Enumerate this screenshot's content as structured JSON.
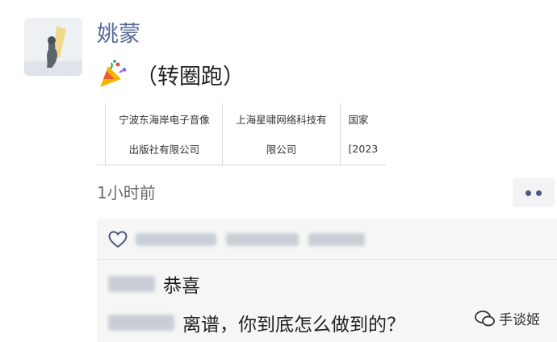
{
  "post": {
    "author": "姚蒙",
    "text": "（转圈跑）",
    "emoji": "party-popper",
    "media_table": {
      "row1": [
        "宁波东海岸电子音像",
        "上海星啸网络科技有",
        "国家"
      ],
      "row2": [
        "出版社有限公司",
        "限公司",
        "[2023"
      ]
    },
    "timestamp": "1小时前"
  },
  "comments": [
    {
      "text": "恭喜"
    },
    {
      "text": "离谱，你到底怎么做到的？"
    }
  ],
  "watermark": {
    "text": "手谈姬"
  },
  "colors": {
    "author": "#576b95",
    "comment_bg": "#f6f6f6",
    "more_dots": "#4c5a7a"
  }
}
